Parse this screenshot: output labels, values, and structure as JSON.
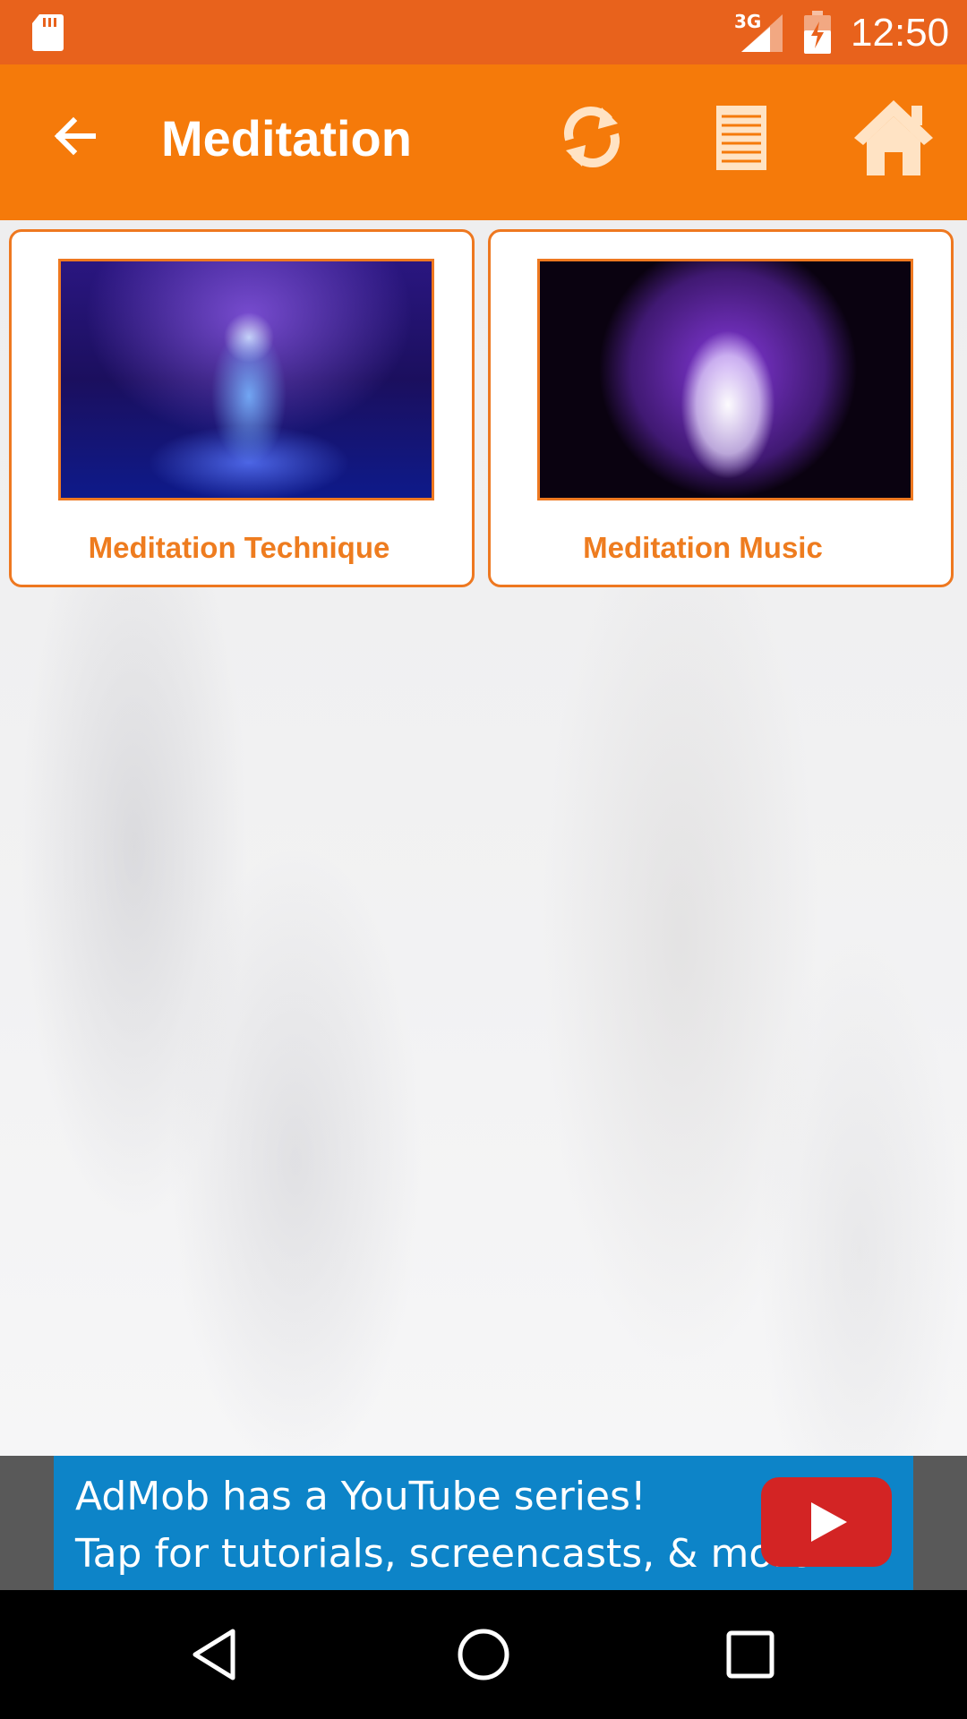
{
  "status_bar": {
    "network": "3G",
    "time": "12:50",
    "icons": [
      "sd-card-icon",
      "signal-icon",
      "battery-charging-icon"
    ]
  },
  "app_bar": {
    "title": "Meditation",
    "icons": [
      "back-arrow-icon",
      "refresh-icon",
      "list-icon",
      "home-icon"
    ]
  },
  "cards": [
    {
      "label": "Meditation Technique",
      "image": "meditating-buddha-image"
    },
    {
      "label": "Meditation Music",
      "image": "aura-meditation-image"
    }
  ],
  "ad": {
    "line1": "AdMob has a YouTube series!",
    "line2": "Tap for tutorials, screencasts, & more.",
    "icon": "youtube-play-icon"
  },
  "nav_bar": {
    "icons": [
      "nav-back-icon",
      "nav-home-icon",
      "nav-recents-icon"
    ]
  },
  "colors": {
    "status_bar": "#e8621c",
    "app_bar": "#f57a0a",
    "accent": "#ee7820",
    "ad_background": "#0d84c8"
  }
}
